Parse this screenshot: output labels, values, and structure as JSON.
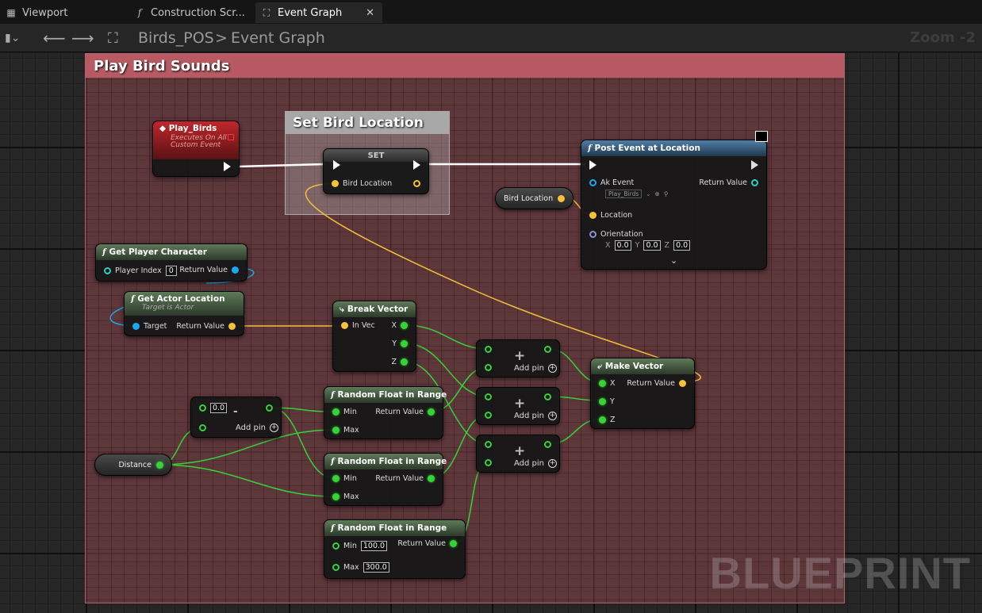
{
  "tabs": [
    {
      "label": "Viewport",
      "icon": "grid-icon"
    },
    {
      "label": "Construction Scr...",
      "icon": "function-icon"
    },
    {
      "label": "Event Graph",
      "icon": "graph-icon",
      "active": true
    }
  ],
  "toolbar": {
    "blueprint": "Birds_POS",
    "separator": ">",
    "graph": "Event Graph",
    "zoom": "Zoom -2"
  },
  "comments": {
    "main": "Play Bird Sounds",
    "set_location": "Set Bird Location"
  },
  "nodes": {
    "event": {
      "title": "Play_Birds",
      "sub1": "Executes On All",
      "sub2": "Custom Event"
    },
    "set": {
      "title": "SET",
      "pin": "Bird Location"
    },
    "post": {
      "title": "Post Event at Location",
      "ak_event": "Ak Event",
      "ak_value": "Play_Birds",
      "return": "Return Value",
      "location": "Location",
      "orientation": "Orientation",
      "x": "0.0",
      "y": "0.0",
      "z": "0.0",
      "xl": "X",
      "yl": "Y",
      "zl": "Z"
    },
    "bird_loc_var": {
      "label": "Bird Location"
    },
    "get_player": {
      "title": "Get Player Character",
      "pin": "Player Index",
      "index": "0",
      "return": "Return Value"
    },
    "get_actor": {
      "title": "Get Actor Location",
      "sub": "Target is Actor",
      "target": "Target",
      "return": "Return Value"
    },
    "break": {
      "title": "Break Vector",
      "in": "In Vec",
      "x": "X",
      "y": "Y",
      "z": "Z"
    },
    "make": {
      "title": "Make Vector",
      "x": "X",
      "y": "Y",
      "z": "Z",
      "return": "Return Value"
    },
    "negate": {
      "value": "0.0",
      "op": "-",
      "addpin": "Add pin"
    },
    "distance": {
      "label": "Distance"
    },
    "rand1": {
      "title": "Random Float in Range",
      "min": "Min",
      "max": "Max",
      "return": "Return Value"
    },
    "rand2": {
      "title": "Random Float in Range",
      "min": "Min",
      "max": "Max",
      "return": "Return Value"
    },
    "rand3": {
      "title": "Random Float in Range",
      "min": "Min",
      "max": "Max",
      "min_val": "100.0",
      "max_val": "300.0",
      "return": "Return Value"
    },
    "add": {
      "op": "+",
      "addpin": "Add pin"
    }
  },
  "watermark": "BLUEPRINT",
  "colors": {
    "comment": "#b85a64",
    "float_pin": "#38d13a",
    "vector_pin": "#f7c13a",
    "object_pin": "#1ba8f0"
  }
}
